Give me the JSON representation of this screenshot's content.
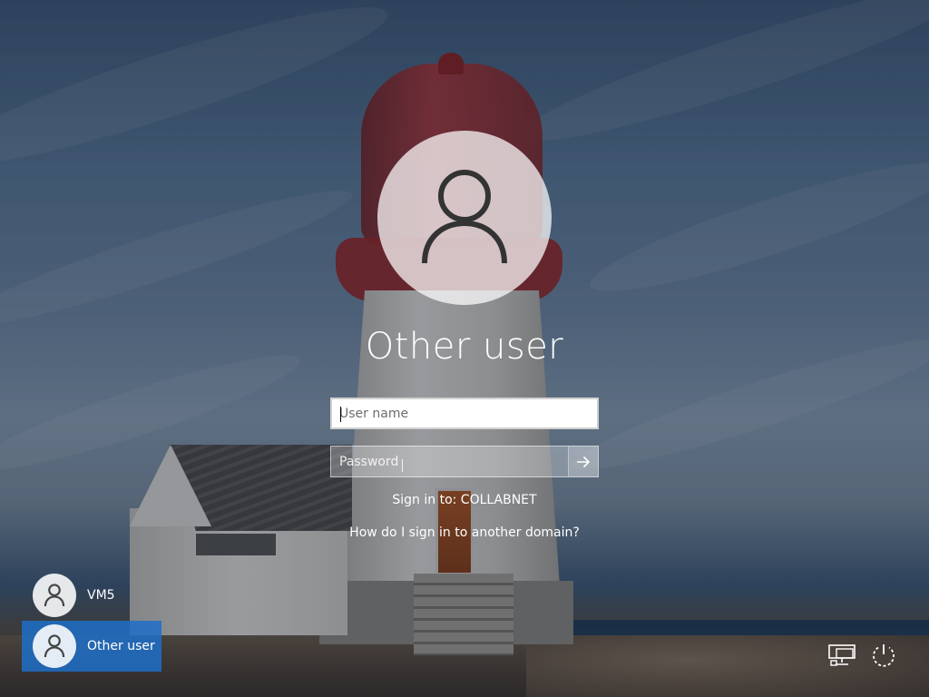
{
  "selected_user": {
    "name": "Other user",
    "avatar_icon": "user-silhouette-icon"
  },
  "form": {
    "username_placeholder": "User name",
    "password_placeholder": "Password",
    "submit_icon": "arrow-right-icon"
  },
  "sign_in_to": "Sign in to: COLLABNET",
  "domain_help_link": "How do I sign in to another domain?",
  "user_list": [
    {
      "name": "VM5",
      "icon": "user-silhouette-icon",
      "selected": false
    },
    {
      "name": "Other user",
      "icon": "user-silhouette-icon",
      "selected": true
    }
  ],
  "corner_icons": {
    "network": "network-icon",
    "power": "power-icon"
  },
  "colors": {
    "selected_tile": "#1e6ec8",
    "input_border": "#d0d0d0"
  }
}
